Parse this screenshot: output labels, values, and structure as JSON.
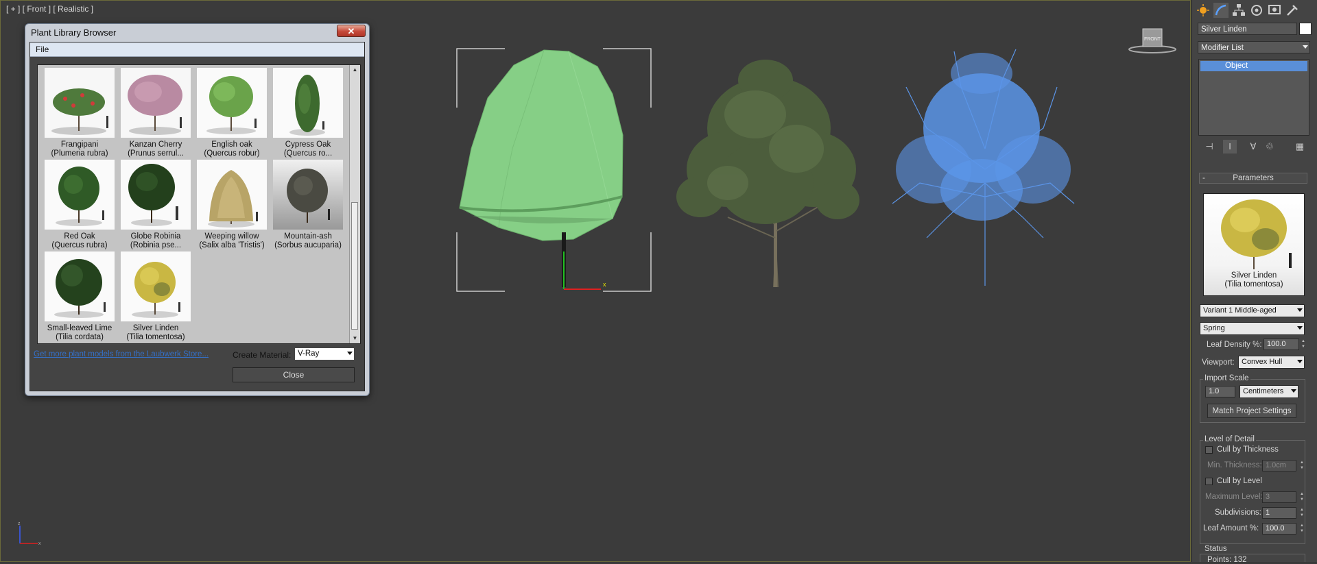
{
  "viewport": {
    "label": "[ + ] [ Front ] [ Realistic ]",
    "viewcube_label": "FRONT"
  },
  "dialog": {
    "title": "Plant Library Browser",
    "close_glyph": "✕",
    "menu_file": "File",
    "plants": [
      {
        "name": "Frangipani",
        "latin": "(Plumeria rubra)"
      },
      {
        "name": "Kanzan Cherry",
        "latin": "(Prunus serrul..."
      },
      {
        "name": "English oak",
        "latin": "(Quercus robur)"
      },
      {
        "name": "Cypress Oak",
        "latin": "(Quercus ro..."
      },
      {
        "name": "Red Oak",
        "latin": "(Quercus rubra)"
      },
      {
        "name": "Globe Robinia",
        "latin": "(Robinia pse..."
      },
      {
        "name": "Weeping willow",
        "latin": "(Salix alba 'Tristis')"
      },
      {
        "name": "Mountain-ash",
        "latin": "(Sorbus aucuparia)"
      },
      {
        "name": "Small-leaved Lime",
        "latin": "(Tilia cordata)"
      },
      {
        "name": "Silver Linden",
        "latin": "(Tilia tomentosa)"
      }
    ],
    "store_link": "Get more plant models from the Laubwerk Store...",
    "create_material_label": "Create Material:",
    "create_material_value": "V-Ray",
    "close_button": "Close"
  },
  "panel": {
    "object_name": "Silver Linden",
    "modifier_list": "Modifier List",
    "stack_item": "Object",
    "parameters_header": "Parameters",
    "rollout_toggle": "-",
    "preview_name": "Silver Linden",
    "preview_latin": "(Tilia tomentosa)",
    "variant": "Variant 1 Middle-aged",
    "season": "Spring",
    "leaf_density_label": "Leaf Density %:",
    "leaf_density_value": "100.0",
    "viewport_label": "Viewport:",
    "viewport_value": "Convex Hull",
    "import_scale_title": "Import Scale",
    "import_scale_value": "1.0",
    "import_scale_unit": "Centimeters",
    "match_button": "Match Project Settings",
    "lod_title": "Level of Detail",
    "cull_thickness": "Cull by Thickness",
    "min_thickness_label": "Min. Thickness:",
    "min_thickness_value": "1.0cm",
    "cull_level": "Cull by Level",
    "max_level_label": "Maximum Level:",
    "max_level_value": "3",
    "subdivisions_label": "Subdivisions:",
    "subdivisions_value": "1",
    "leaf_amount_label": "Leaf Amount %:",
    "leaf_amount_value": "100.0",
    "status_title": "Status",
    "points_label": "Points: 132"
  },
  "colors": {
    "hull_green": "#86cf86",
    "wire_blue": "#5b95e8",
    "selection_blue": "#5a8fd8"
  }
}
